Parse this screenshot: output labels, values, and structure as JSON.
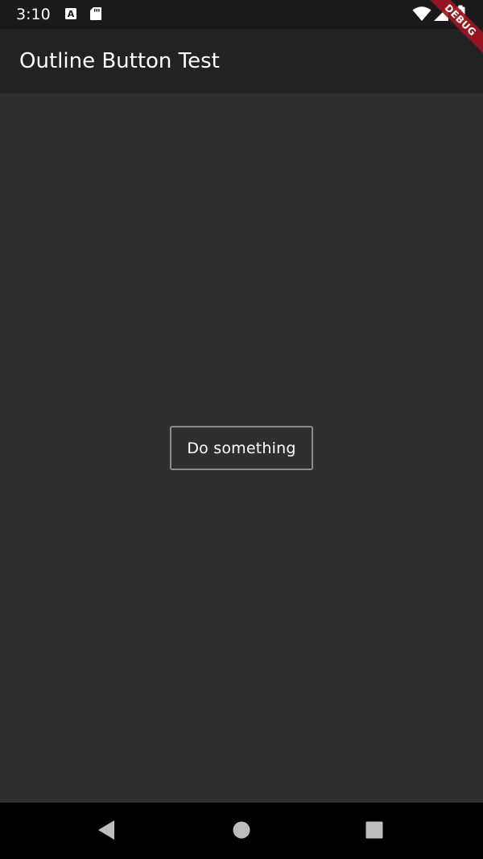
{
  "status_bar": {
    "time": "3:10",
    "icons": [
      "a-badge-icon",
      "sd-card-icon",
      "wifi-icon",
      "cell-signal-icon",
      "battery-charging-icon"
    ]
  },
  "app_bar": {
    "title": "Outline Button Test",
    "background": "#222124"
  },
  "body": {
    "background": "#302e31",
    "button": {
      "label": "Do something",
      "border_color": "#8c8a8d",
      "text_color": "#ffffff"
    }
  },
  "debug_banner": {
    "label": "DEBUG",
    "color": "#a0141e"
  },
  "nav_bar": {
    "buttons": [
      "back-icon",
      "home-icon",
      "recents-icon"
    ]
  }
}
